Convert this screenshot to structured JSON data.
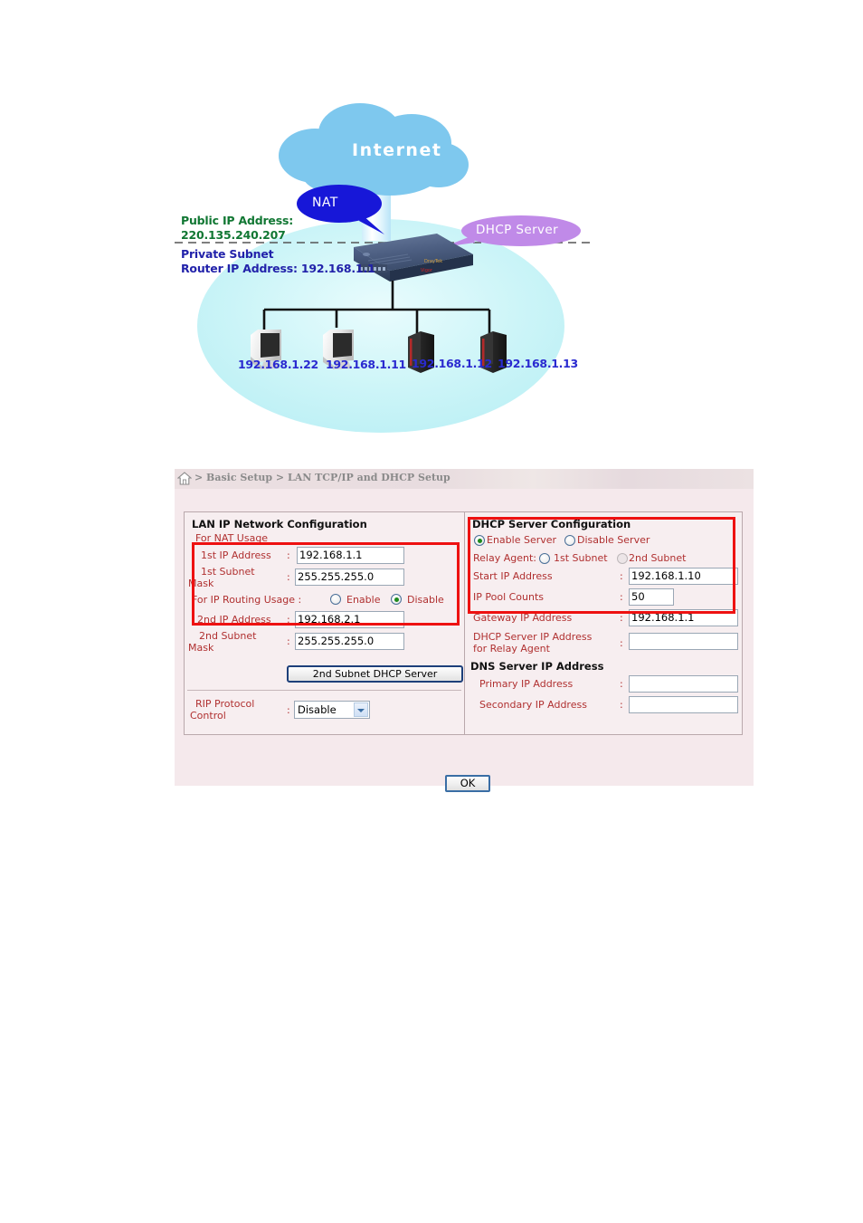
{
  "diagram": {
    "cloud_label": "Internet",
    "nat_bubble": "NAT",
    "dhcp_bubble": "DHCP Server",
    "public_ip_title": "Public IP Address:",
    "public_ip_value": "220.135.240.207",
    "private_subnet_label": "Private Subnet",
    "router_ip_label": "Router IP Address: 192.168.1.1",
    "hosts": [
      {
        "type": "pc",
        "ip": "192.168.1.22"
      },
      {
        "type": "pc",
        "ip": "192.168.1.11"
      },
      {
        "type": "server",
        "ip": "192.168.1.12"
      },
      {
        "type": "server",
        "ip": "192.168.1.13"
      }
    ]
  },
  "webui": {
    "breadcrumb": "> Basic Setup > LAN TCP/IP and DHCP Setup",
    "home_icon": "home-icon",
    "lan": {
      "section_title": "LAN IP Network Configuration",
      "for_nat_usage": "For NAT Usage",
      "first_ip_label": "1st IP Address",
      "first_ip_value": "192.168.1.1",
      "first_mask_label_line1": "1st Subnet",
      "first_mask_label_line2": "Mask",
      "first_mask_value": "255.255.255.0",
      "routing_usage_label": "For IP Routing Usage  :",
      "routing_enable_label": "Enable",
      "routing_disable_label": "Disable",
      "routing_selected": "Disable",
      "second_ip_label": "2nd IP Address",
      "second_ip_value": "192.168.2.1",
      "second_mask_label_line1": "2nd Subnet",
      "second_mask_label_line2": "Mask",
      "second_mask_value": "255.255.255.0",
      "second_subnet_dhcp_button": "2nd Subnet DHCP Server",
      "rip_label_line1": "RIP Protocol",
      "rip_label_line2": "Control",
      "rip_value": "Disable"
    },
    "dhcp": {
      "section_title": "DHCP Server Configuration",
      "enable_server_label": "Enable Server",
      "disable_server_label": "Disable Server",
      "server_selected": "Enable Server",
      "relay_agent_label": "Relay Agent:",
      "relay_first_subnet_label": "1st Subnet",
      "relay_second_subnet_label": "2nd Subnet",
      "relay_selected": "",
      "start_ip_label": "Start IP Address",
      "start_ip_value": "192.168.1.10",
      "pool_counts_label": "IP Pool Counts",
      "pool_counts_value": "50",
      "gateway_ip_label": "Gateway IP Address",
      "gateway_ip_value": "192.168.1.1",
      "relay_server_label_line1": "DHCP Server IP Address",
      "relay_server_label_line2": "for Relay Agent",
      "relay_server_value": "",
      "dns_section_title": "DNS Server IP Address",
      "dns_primary_label": "Primary IP Address",
      "dns_primary_value": "",
      "dns_secondary_label": "Secondary IP Address",
      "dns_secondary_value": "",
      "colon": ":"
    },
    "ok_button": "OK"
  },
  "colors": {
    "highlight_red": "#ee1111",
    "label_red": "#b03030",
    "panel_pink": "#f5e9ec",
    "public_green": "#117733",
    "private_blue": "#2222aa",
    "host_blue": "#2a2ad0",
    "nat_bubble": "#1717d8",
    "dhcp_bubble": "#c08ae8",
    "cloud": "#7ec8ee",
    "lan_ellipse": "#ccf6f8"
  }
}
